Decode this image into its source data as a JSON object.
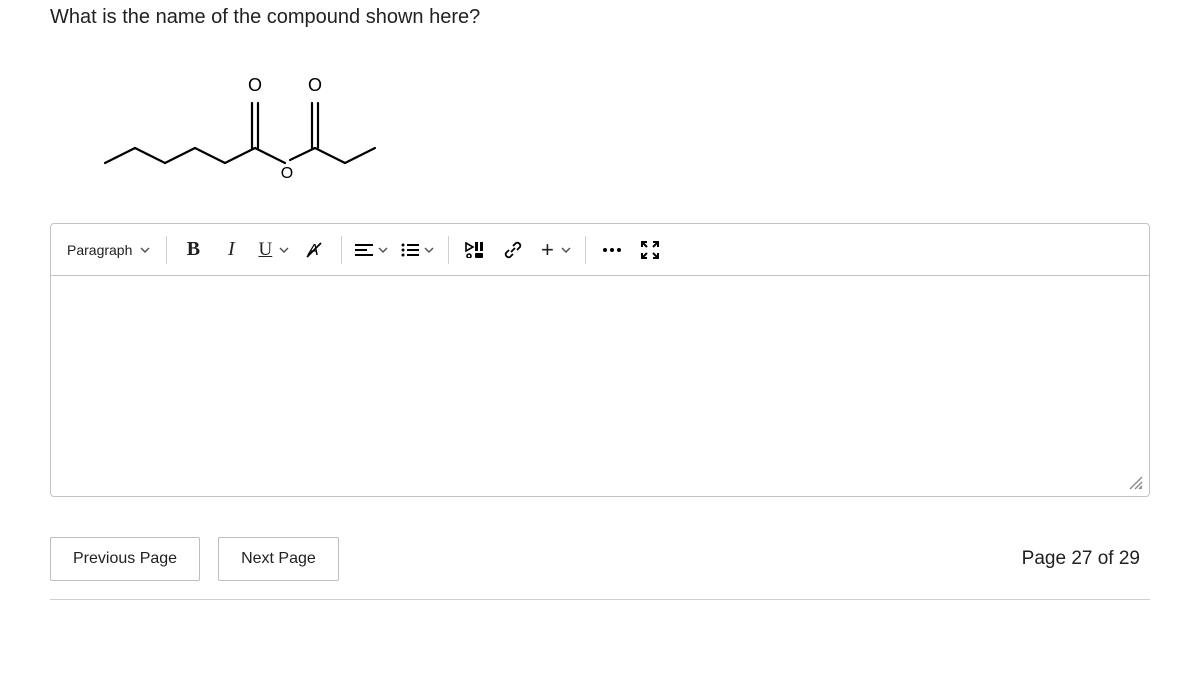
{
  "question": "What is the name of the compound shown here?",
  "toolbar": {
    "paragraph_label": "Paragraph",
    "bold": "B",
    "italic": "I",
    "underline": "U",
    "clear_format": "A",
    "plus": "+",
    "more": "…"
  },
  "nav": {
    "prev": "Previous Page",
    "next": "Next Page"
  },
  "page_status": "Page 27 of 29"
}
